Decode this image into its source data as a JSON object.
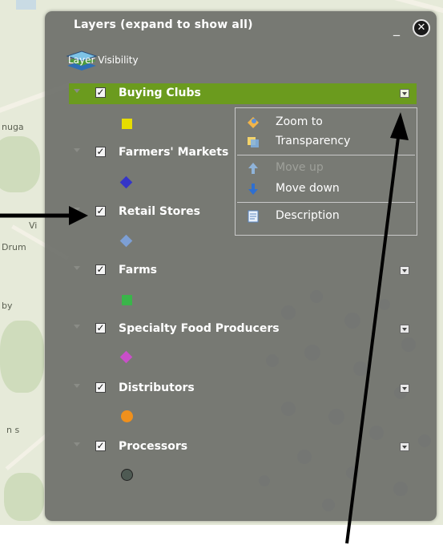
{
  "map": {
    "labels": [
      "nuga",
      "Vi",
      "Drum",
      "by",
      "n s"
    ]
  },
  "panel": {
    "title": "Layers (expand to show all)",
    "subtitle": "Layer Visibility",
    "minimize_glyph": "_",
    "close_glyph": "✕"
  },
  "layers": [
    {
      "label": "Buying Clubs",
      "checked": true,
      "symbol": "square",
      "color": "#e6dd00",
      "selected": true
    },
    {
      "label": "Farmers' Markets",
      "checked": true,
      "symbol": "diamond",
      "color": "#3535c8"
    },
    {
      "label": "Retail Stores",
      "checked": true,
      "symbol": "diamond",
      "color": "#7d9fd4"
    },
    {
      "label": "Farms",
      "checked": true,
      "symbol": "square",
      "color": "#3ab54a"
    },
    {
      "label": "Specialty Food Producers",
      "checked": true,
      "symbol": "diamond",
      "color": "#c94fc9"
    },
    {
      "label": "Distributors",
      "checked": true,
      "symbol": "circle",
      "color": "#f0901c"
    },
    {
      "label": "Processors",
      "checked": true,
      "symbol": "circle",
      "color": "#4e5a53"
    }
  ],
  "checkbox_glyph": "✓",
  "context_menu": {
    "items": [
      {
        "label": "Zoom to",
        "icon": "zoom-icon",
        "enabled": true
      },
      {
        "label": "Transparency",
        "icon": "transparency-icon",
        "enabled": true
      },
      {
        "label": "Move up",
        "icon": "arrow-up-icon",
        "enabled": false
      },
      {
        "label": "Move down",
        "icon": "arrow-down-icon",
        "enabled": true
      },
      {
        "label": "Description",
        "icon": "document-icon",
        "enabled": true
      }
    ]
  },
  "colors": {
    "selected_row": "#6b9b1e",
    "panel_background": "#70726c",
    "arrow": "#000000"
  }
}
